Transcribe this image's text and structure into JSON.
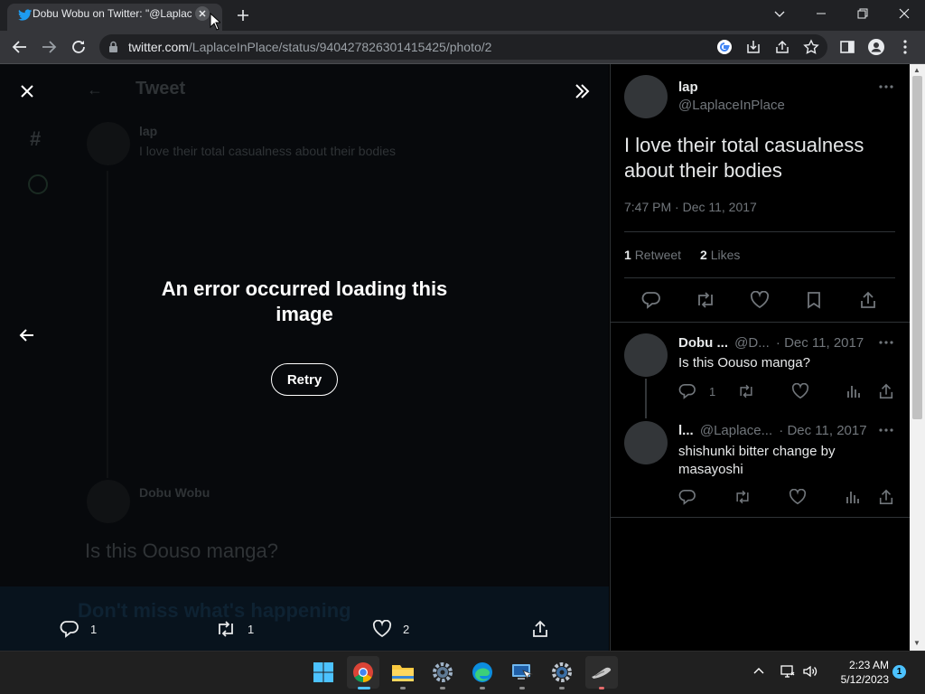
{
  "browser": {
    "tab_title": "Dobu Wobu on Twitter: \"@Laplac",
    "url_host": "twitter.com",
    "url_path": "/LaplaceInPlace/status/940427826301415425/photo/2"
  },
  "viewer": {
    "error_text": "An error occurred loading this image",
    "retry_label": "Retry",
    "reply_count": "1",
    "retweet_count": "1",
    "like_count": "2",
    "background": {
      "header": "Tweet",
      "author": "lap",
      "tweet_preview": "I love their total casualness about their bodies",
      "reply_author": "Dobu Wobu",
      "reply_text": "Is this Oouso manga?",
      "footer_text": "Don't miss what's happening"
    }
  },
  "tweet": {
    "author_name": "lap",
    "author_handle": "@LaplaceInPlace",
    "text": "I love their total casualness about their bodies",
    "timestamp": "7:47 PM · Dec 11, 2017",
    "retweet_count": "1",
    "retweet_label": "Retweet",
    "like_count": "2",
    "like_label": "Likes"
  },
  "replies": [
    {
      "name": "Dobu ...",
      "handle": "@D...",
      "date": "· Dec 11, 2017",
      "text": "Is this Oouso manga?",
      "reply_count": "1"
    },
    {
      "name": "l...",
      "handle": "@Laplace...",
      "date": "· Dec 11, 2017",
      "text": "shishunki bitter change by masayoshi",
      "reply_count": ""
    }
  ],
  "taskbar": {
    "time": "2:23 AM",
    "date": "5/12/2023",
    "notification_count": "1"
  },
  "colors": {
    "twitter_blue": "#1d9bf0",
    "panel_bg": "#000000",
    "viewer_bg": "#07090c",
    "taskbar_bg": "#202020"
  }
}
